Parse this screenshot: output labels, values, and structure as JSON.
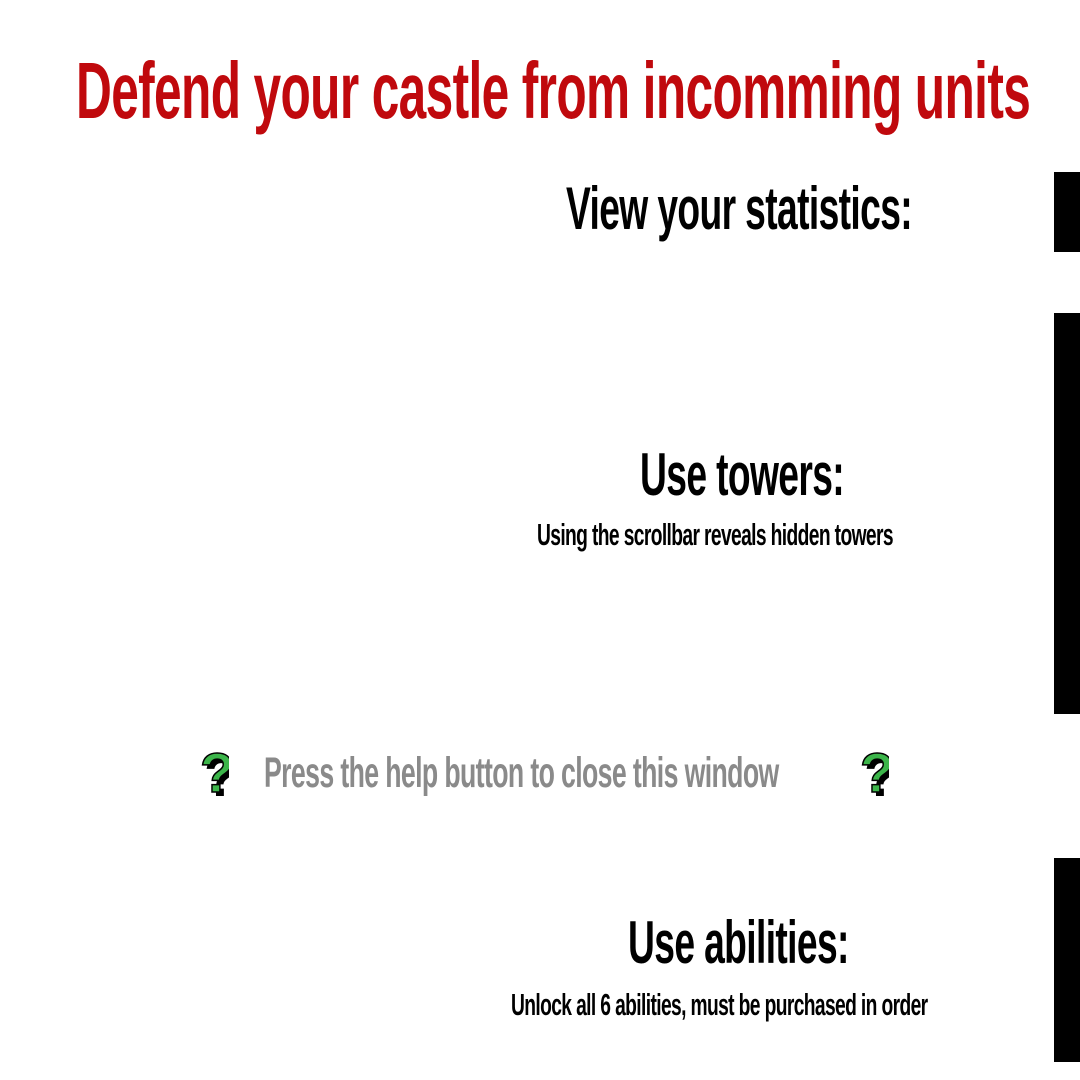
{
  "title": "Defend your castle from incomming units",
  "sections": {
    "stats": {
      "heading": "View your statistics:"
    },
    "towers": {
      "heading": "Use towers:",
      "subtext": "Using the scrollbar reveals hidden towers"
    },
    "abilities": {
      "heading": "Use abilities:",
      "subtext": "Unlock all 6 abilities, must be purchased in order"
    }
  },
  "help": {
    "text": "Press the help button to close this window",
    "icon": "question-mark-icon",
    "icon_color": "#3cb54a"
  },
  "colors": {
    "title": "#c0090d",
    "heading": "#000000",
    "help_text": "#8a8a8a",
    "pointer_bars": "#000000"
  }
}
